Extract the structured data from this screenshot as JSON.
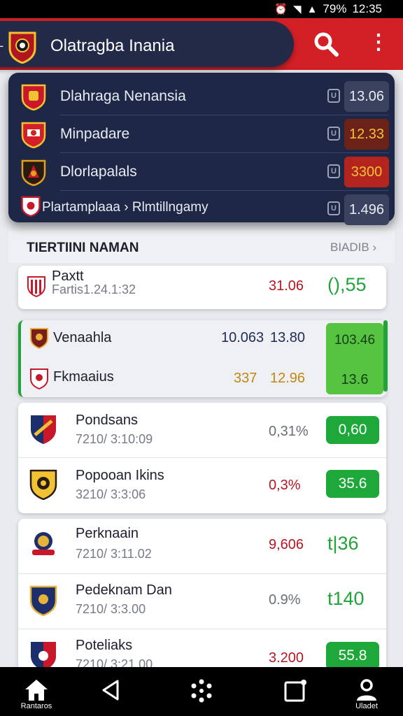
{
  "status": {
    "battery": "79%",
    "time": "12:35"
  },
  "app_bar": {
    "title": "Olatragba Inania"
  },
  "dropdown": {
    "items": [
      {
        "name": "Dlahraga Nenansia",
        "value": "13.06"
      },
      {
        "name": "Minpadare",
        "value": "12.33"
      },
      {
        "name": "Dlorlapalals",
        "value": "3300"
      },
      {
        "name": "Plartamplaaa",
        "separator": "›",
        "name2": "Rlmtillngamy",
        "value": "1.496"
      }
    ]
  },
  "list": {
    "title": "TIERTIINI NAMAN",
    "sort_label": "BIADIB",
    "rows": [
      {
        "team": "Paxtt",
        "sub": "Fartis1.24.1:32",
        "odds": "31.06",
        "score": "(),55"
      },
      {
        "team": "Venaahla",
        "odds1": "10.063",
        "odds2": "13.80",
        "value": "103.46"
      },
      {
        "team": "Fkmaaius",
        "odds1": "337",
        "odds2": "12.96",
        "value": "13.6"
      },
      {
        "team": "Pondsans",
        "sub": "7210/ 3:10:09",
        "odds": "0,31%",
        "value": "0,60"
      },
      {
        "team": "Popooan Ikins",
        "sub": "3210/ 3:3:06",
        "odds": "0,3%",
        "value": "35.6"
      },
      {
        "team": "Perknaain",
        "sub": "7210/ 3:11.02",
        "odds": "9,606",
        "score": "t|36"
      },
      {
        "team": "Pedeknam Dan",
        "sub": "7210/ 3:3.00",
        "odds": "0.9%",
        "score": "t140"
      },
      {
        "team": "Poteliaks",
        "sub": "7210/ 3:21.00",
        "odds": "3.200",
        "value": "55.8"
      }
    ]
  },
  "bottom_nav": {
    "items": [
      {
        "icon": "home-icon",
        "label": "Rantaros"
      },
      {
        "icon": "back-triangle-icon",
        "label": ""
      },
      {
        "icon": "dots-circle-icon",
        "label": ""
      },
      {
        "icon": "square-badge-icon",
        "label": ""
      },
      {
        "icon": "user-icon",
        "label": "Uladet"
      }
    ]
  },
  "colors": {
    "brand_red": "#d32026",
    "navy": "#1e2746",
    "green": "#1fa83a",
    "odds_red": "#b5161f"
  }
}
